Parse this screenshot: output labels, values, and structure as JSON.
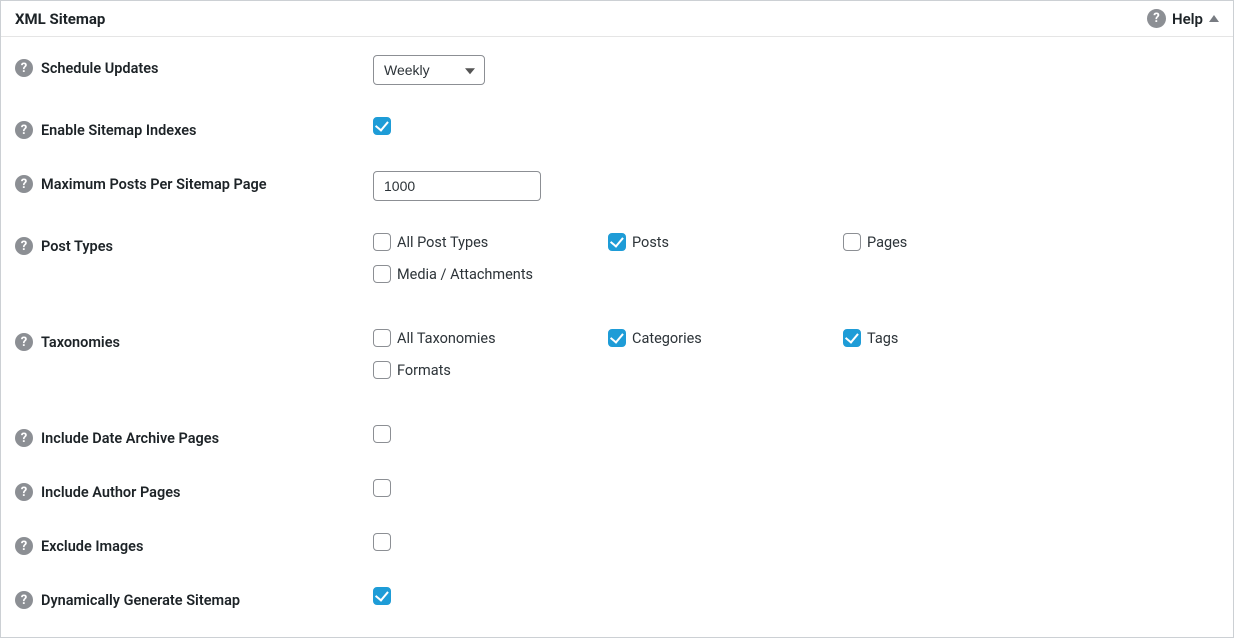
{
  "panel": {
    "title": "XML Sitemap",
    "help_label": "Help"
  },
  "rows": {
    "schedule_updates": {
      "label": "Schedule Updates",
      "value": "Weekly"
    },
    "enable_sitemap_indexes": {
      "label": "Enable Sitemap Indexes",
      "checked": true
    },
    "max_posts": {
      "label": "Maximum Posts Per Sitemap Page",
      "value": "1000"
    },
    "post_types": {
      "label": "Post Types",
      "options": [
        {
          "label": "All Post Types",
          "checked": false
        },
        {
          "label": "Posts",
          "checked": true
        },
        {
          "label": "Pages",
          "checked": false
        },
        {
          "label": "Media / Attachments",
          "checked": false
        }
      ]
    },
    "taxonomies": {
      "label": "Taxonomies",
      "options": [
        {
          "label": "All Taxonomies",
          "checked": false
        },
        {
          "label": "Categories",
          "checked": true
        },
        {
          "label": "Tags",
          "checked": true
        },
        {
          "label": "Formats",
          "checked": false
        }
      ]
    },
    "include_date_archive": {
      "label": "Include Date Archive Pages",
      "checked": false
    },
    "include_author_pages": {
      "label": "Include Author Pages",
      "checked": false
    },
    "exclude_images": {
      "label": "Exclude Images",
      "checked": false
    },
    "dynamically_generate": {
      "label": "Dynamically Generate Sitemap",
      "checked": true
    }
  }
}
